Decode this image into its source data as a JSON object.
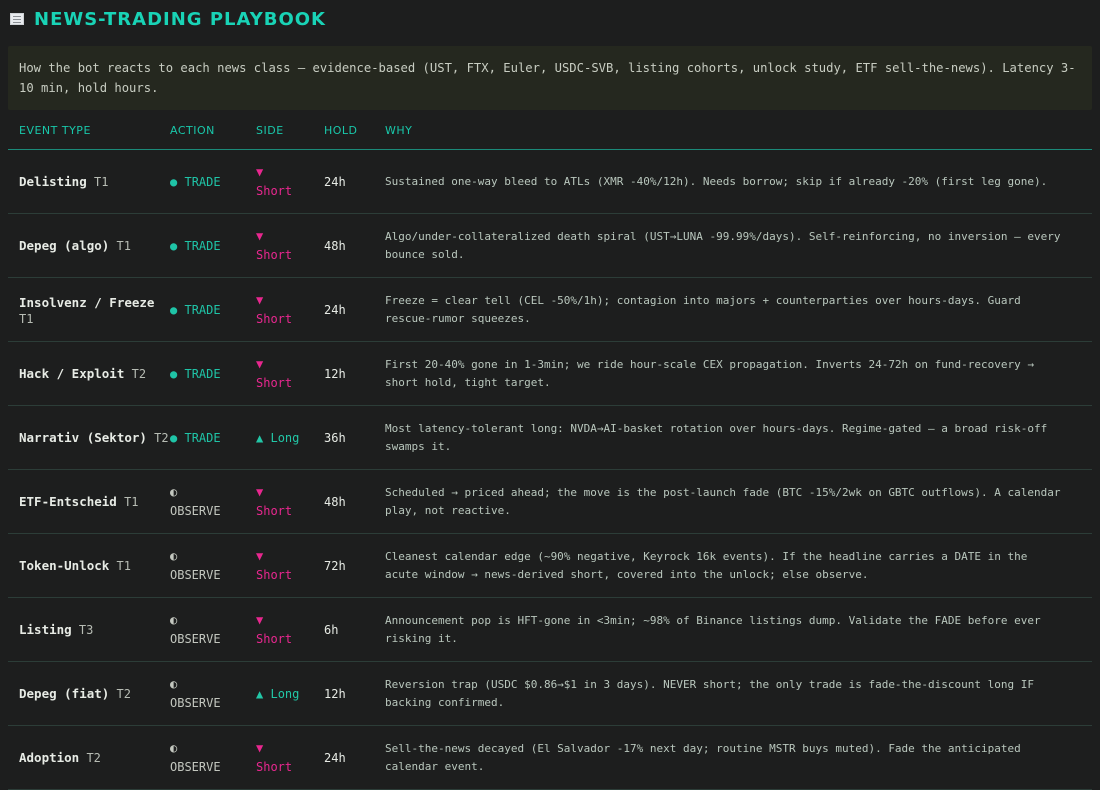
{
  "header": {
    "icon": "newspaper-icon",
    "title": "NEWS-TRADING PLAYBOOK"
  },
  "intro": "How the bot reacts to each news class — evidence-based (UST, FTX, Euler, USDC-SVB, listing cohorts, unlock study, ETF sell-the-news). Latency 3-10 min, hold hours.",
  "table": {
    "columns": [
      "EVENT TYPE",
      "ACTION",
      "SIDE",
      "HOLD",
      "WHY"
    ],
    "rows": [
      {
        "event": "Delisting",
        "tier": "T1",
        "action_symbol": "●",
        "action": "TRADE",
        "side_symbol": "▼",
        "side": "Short",
        "hold": "24h",
        "why": "Sustained one-way bleed to ATLs (XMR -40%/12h). Needs borrow; skip if already -20% (first leg gone)."
      },
      {
        "event": "Depeg (algo)",
        "tier": "T1",
        "action_symbol": "●",
        "action": "TRADE",
        "side_symbol": "▼",
        "side": "Short",
        "hold": "48h",
        "why": "Algo/under-collateralized death spiral (UST→LUNA -99.99%/days). Self-reinforcing, no inversion — every bounce sold."
      },
      {
        "event": "Insolvenz / Freeze",
        "tier": "T1",
        "action_symbol": "●",
        "action": "TRADE",
        "side_symbol": "▼",
        "side": "Short",
        "hold": "24h",
        "why": "Freeze = clear tell (CEL -50%/1h); contagion into majors + counterparties over hours-days. Guard rescue-rumor squeezes."
      },
      {
        "event": "Hack / Exploit",
        "tier": "T2",
        "action_symbol": "●",
        "action": "TRADE",
        "side_symbol": "▼",
        "side": "Short",
        "hold": "12h",
        "why": "First 20-40% gone in 1-3min; we ride hour-scale CEX propagation. Inverts 24-72h on fund-recovery → short hold, tight target."
      },
      {
        "event": "Narrativ (Sektor)",
        "tier": "T2",
        "action_symbol": "●",
        "action": "TRADE",
        "side_symbol": "▲",
        "side": "Long",
        "hold": "36h",
        "why": "Most latency-tolerant long: NVDA→AI-basket rotation over hours-days. Regime-gated — a broad risk-off swamps it."
      },
      {
        "event": "ETF-Entscheid",
        "tier": "T1",
        "action_symbol": "◐",
        "action": "OBSERVE",
        "side_symbol": "▼",
        "side": "Short",
        "hold": "48h",
        "why": "Scheduled → priced ahead; the move is the post-launch fade (BTC -15%/2wk on GBTC outflows). A calendar play, not reactive."
      },
      {
        "event": "Token-Unlock",
        "tier": "T1",
        "action_symbol": "◐",
        "action": "OBSERVE",
        "side_symbol": "▼",
        "side": "Short",
        "hold": "72h",
        "why": "Cleanest calendar edge (~90% negative, Keyrock 16k events). If the headline carries a DATE in the acute window → news-derived short, covered into the unlock; else observe."
      },
      {
        "event": "Listing",
        "tier": "T3",
        "action_symbol": "◐",
        "action": "OBSERVE",
        "side_symbol": "▼",
        "side": "Short",
        "hold": "6h",
        "why": "Announcement pop is HFT-gone in <3min; ~98% of Binance listings dump. Validate the FADE before ever risking it."
      },
      {
        "event": "Depeg (fiat)",
        "tier": "T2",
        "action_symbol": "◐",
        "action": "OBSERVE",
        "side_symbol": "▲",
        "side": "Long",
        "hold": "12h",
        "why": "Reversion trap (USDC $0.86→$1 in 3 days). NEVER short; the only trade is fade-the-discount long IF backing confirmed."
      },
      {
        "event": "Adoption",
        "tier": "T2",
        "action_symbol": "◐",
        "action": "OBSERVE",
        "side_symbol": "▼",
        "side": "Short",
        "hold": "24h",
        "why": "Sell-the-news decayed (El Salvador -17% next day; routine MSTR buys muted). Fade the anticipated calendar event."
      }
    ]
  }
}
